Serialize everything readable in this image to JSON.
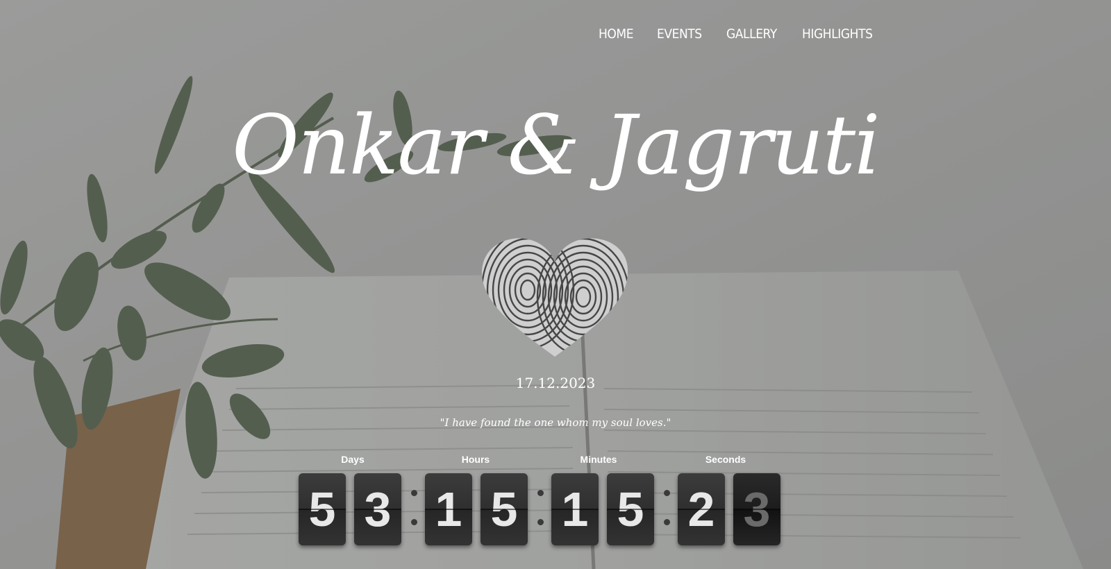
{
  "nav": {
    "items": [
      "HOME",
      "EVENTS",
      "GALLERY",
      "HIGHLIGHTS"
    ]
  },
  "couple_names": "Onkar & Jagruti",
  "date": "17.12.2023",
  "quote": "\"I have found the one whom my soul loves.\"",
  "countdown": {
    "labels": {
      "days": "Days",
      "hours": "Hours",
      "minutes": "Minutes",
      "seconds": "Seconds"
    },
    "digits": [
      "5",
      "3",
      "1",
      "5",
      "1",
      "5",
      "2",
      "3"
    ]
  },
  "colors": {
    "text": "#ffffff",
    "flip_card": "#333333",
    "flip_digit": "#e8e8e8"
  }
}
